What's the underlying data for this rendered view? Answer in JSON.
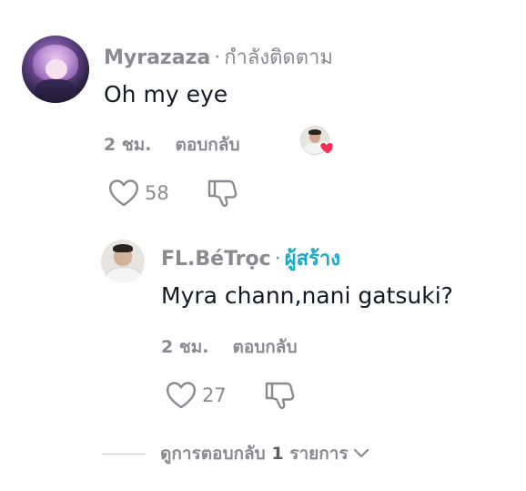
{
  "comment": {
    "username": "Myrazaza",
    "separator": "·",
    "follow_status": "กำลังติดตาม",
    "text": "Oh my eye",
    "time": "2 ชม.",
    "reply_label": "ตอบกลับ",
    "like_count": "58"
  },
  "reply": {
    "username": "FL.BéTrọc",
    "separator": "·",
    "creator_badge": "ผู้สร้าง",
    "text": "Myra chann,nani gatsuki?",
    "time": "2 ชม.",
    "reply_label": "ตอบกลับ",
    "like_count": "27"
  },
  "view_more": {
    "prefix": "ดูการตอบกลับ",
    "count": "1",
    "suffix": "รายการ"
  },
  "colors": {
    "secondary_text": "#8a8b91",
    "creator_badge": "#1aa9c4",
    "heart": "#fe2c55"
  },
  "icons": {
    "like": "heart-outline-icon",
    "dislike": "thumbs-down-outline-icon",
    "expand": "chevron-down-icon",
    "liked_by_creator": "heart-filled-icon"
  }
}
